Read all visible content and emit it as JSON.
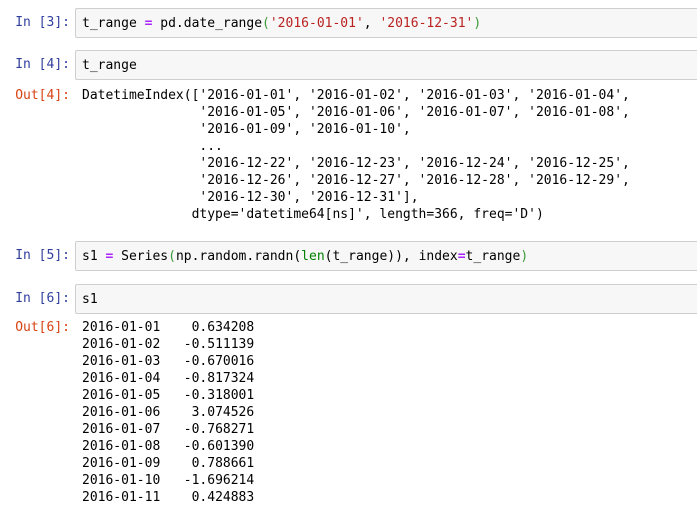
{
  "cells": [
    {
      "prompt": "In [3]:",
      "code_parts": {
        "a": "t_range ",
        "b": "=",
        "c": " pd.date_range",
        "d": "(",
        "e": "'2016-01-01'",
        "f": ", ",
        "g": "'2016-12-31'",
        "h": ")"
      }
    },
    {
      "prompt": "In [4]:",
      "code": "t_range",
      "out_prompt": "Out[4]:",
      "output_lines": [
        "DatetimeIndex(['2016-01-01', '2016-01-02', '2016-01-03', '2016-01-04',",
        "               '2016-01-05', '2016-01-06', '2016-01-07', '2016-01-08',",
        "               '2016-01-09', '2016-01-10',",
        "               ...",
        "               '2016-12-22', '2016-12-23', '2016-12-24', '2016-12-25',",
        "               '2016-12-26', '2016-12-27', '2016-12-28', '2016-12-29',",
        "               '2016-12-30', '2016-12-31'],",
        "              dtype='datetime64[ns]', length=366, freq='D')"
      ]
    },
    {
      "prompt": "In [5]:",
      "code_parts": {
        "a": "s1 ",
        "b": "=",
        "c": " Series",
        "d": "(",
        "e": "np.random.randn(",
        "f": "len",
        "g": "(t_range)), index",
        "h": "=",
        "i": "t_range",
        "j": ")"
      }
    },
    {
      "prompt": "In [6]:",
      "code": "s1",
      "out_prompt": "Out[6]:",
      "series_rows": [
        {
          "date": "2016-01-01",
          "value": "0.634208"
        },
        {
          "date": "2016-01-02",
          "value": "-0.511139"
        },
        {
          "date": "2016-01-03",
          "value": "-0.670016"
        },
        {
          "date": "2016-01-04",
          "value": "-0.817324"
        },
        {
          "date": "2016-01-05",
          "value": "-0.318001"
        },
        {
          "date": "2016-01-06",
          "value": "3.074526"
        },
        {
          "date": "2016-01-07",
          "value": "-0.768271"
        },
        {
          "date": "2016-01-08",
          "value": "-0.601390"
        },
        {
          "date": "2016-01-09",
          "value": "0.788661"
        },
        {
          "date": "2016-01-10",
          "value": "-1.696214"
        },
        {
          "date": "2016-01-11",
          "value": "0.424883"
        }
      ]
    }
  ],
  "colors": {
    "in_prompt": "#303f9f",
    "out_prompt": "#d84315",
    "input_bg": "#f7f7f7",
    "input_border": "#cfcfcf",
    "keyword": "#aa22ff",
    "string": "#ba2121",
    "paren": "#3a9a3a",
    "builtin": "#008000"
  }
}
